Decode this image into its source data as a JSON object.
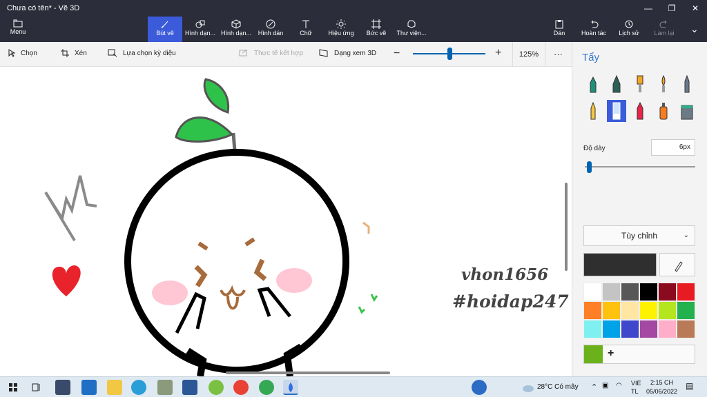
{
  "window": {
    "title": "Chưa có tên* - Vẽ 3D"
  },
  "ribbon": {
    "menu": "Menu",
    "tools": [
      "Bút vẽ",
      "Hình dạn...",
      "Hình dạn...",
      "Hình dán",
      "Chữ",
      "Hiệu ứng",
      "Bức vẽ",
      "Thư viện..."
    ],
    "right": [
      "Dán",
      "Hoàn tác",
      "Lịch sử",
      "Làm lại"
    ]
  },
  "toolbar": {
    "select": "Chọn",
    "crop": "Xén",
    "magic_select": "Lựa chọn kỳ diệu",
    "mixed_reality": "Thực tế kết hợp",
    "view_3d": "Dạng xem 3D",
    "zoom_minus": "−",
    "zoom_plus": "+",
    "zoom": "125%",
    "more": "···"
  },
  "canvas": {
    "watermark_line1": "vhon1656",
    "watermark_line2": "#hoidap247"
  },
  "panel": {
    "title": "Tẩy",
    "brushes": [
      "marker",
      "calligraphy-pen",
      "oil-brush",
      "watercolor",
      "pixel-pen",
      "pencil",
      "eraser",
      "crayon",
      "spray-can",
      "fill"
    ],
    "active_brush": "eraser",
    "thickness_label": "Độ dày",
    "thickness_value": "6px",
    "thickness_fraction": 0.02,
    "custom_label": "Tùy chỉnh",
    "custom_chevron": "⌄",
    "add_symbol": "+",
    "current_color": "#2f2f2f",
    "swatches": [
      "#ffffff",
      "#c4c4c4",
      "#575757",
      "#000000",
      "#8a0a1e",
      "#e81b23",
      "#ff7f27",
      "#ffc20e",
      "#ffe7a3",
      "#fff200",
      "#b5e61d",
      "#22b14c",
      "#7ef0f0",
      "#00a2e8",
      "#3f48cc",
      "#a349a4",
      "#ffaec9",
      "#b97a57"
    ],
    "custom_swatch": "#6bb11b"
  },
  "taskbar": {
    "weather": "28°C  Có mây",
    "lang1": "VIE",
    "lang2": "TL",
    "time": "2:15 CH",
    "date": "05/06/2022"
  }
}
